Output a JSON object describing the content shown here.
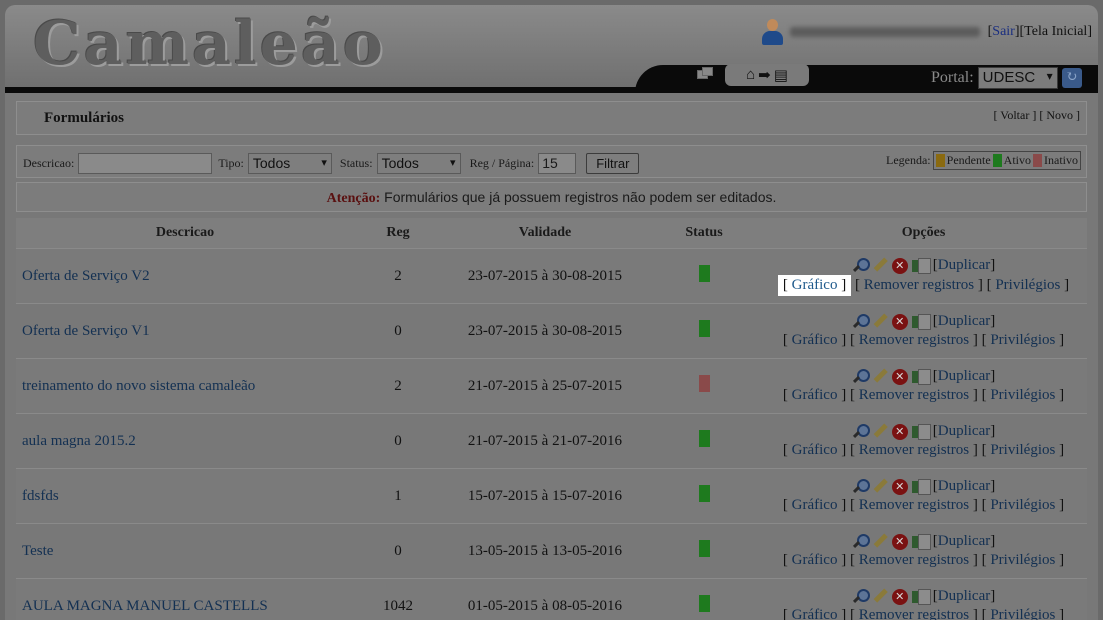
{
  "header": {
    "logo": "Camaleão",
    "logout_link": "Sair",
    "home_link": "Tela Inicial",
    "portal_label": "Portal:",
    "portal_value": "UDESC"
  },
  "page": {
    "title": "Formulários",
    "back_link": "Voltar",
    "new_link": "Novo"
  },
  "filter": {
    "descricao_label": "Descricao:",
    "tipo_label": "Tipo:",
    "tipo_value": "Todos",
    "status_label": "Status:",
    "status_value": "Todos",
    "perpage_label": "Reg / Página:",
    "perpage_value": "15",
    "filter_button": "Filtrar",
    "legend_label": "Legenda:",
    "legend": [
      {
        "label": "Pendente",
        "color": "#8a6a10"
      },
      {
        "label": "Ativo",
        "color": "#1e7a1e"
      },
      {
        "label": "Inativo",
        "color": "#8a4a4a"
      }
    ]
  },
  "notice": {
    "label": "Atenção:",
    "text": " Formulários que já possuem registros não podem ser editados."
  },
  "table": {
    "headers": [
      "Descricao",
      "Reg",
      "Validade",
      "Status",
      "Opções"
    ],
    "option_labels": {
      "duplicate": "Duplicar",
      "chart": "Gráfico",
      "remove": "Remover registros",
      "privileges": "Privilégios"
    },
    "rows": [
      {
        "descricao": "Oferta de Serviço V2",
        "reg": "2",
        "validade": "23-07-2015 à 30-08-2015",
        "status": "ativo",
        "status_color": "#1e7a1e"
      },
      {
        "descricao": "Oferta de Serviço V1",
        "reg": "0",
        "validade": "23-07-2015 à 30-08-2015",
        "status": "ativo",
        "status_color": "#1e7a1e"
      },
      {
        "descricao": "treinamento do novo sistema camaleão",
        "reg": "2",
        "validade": "21-07-2015 à 25-07-2015",
        "status": "inativo",
        "status_color": "#8a4a4a"
      },
      {
        "descricao": "aula magna 2015.2",
        "reg": "0",
        "validade": "21-07-2015 à 21-07-2016",
        "status": "ativo",
        "status_color": "#1e7a1e"
      },
      {
        "descricao": "fdsfds",
        "reg": "1",
        "validade": "15-07-2015 à 15-07-2016",
        "status": "ativo",
        "status_color": "#1e7a1e"
      },
      {
        "descricao": "Teste",
        "reg": "0",
        "validade": "13-05-2015 à 13-05-2016",
        "status": "ativo",
        "status_color": "#1e7a1e"
      },
      {
        "descricao": "AULA MAGNA MANUEL CASTELLS",
        "reg": "1042",
        "validade": "01-05-2015 à 08-05-2016",
        "status": "ativo",
        "status_color": "#1e7a1e"
      }
    ]
  }
}
